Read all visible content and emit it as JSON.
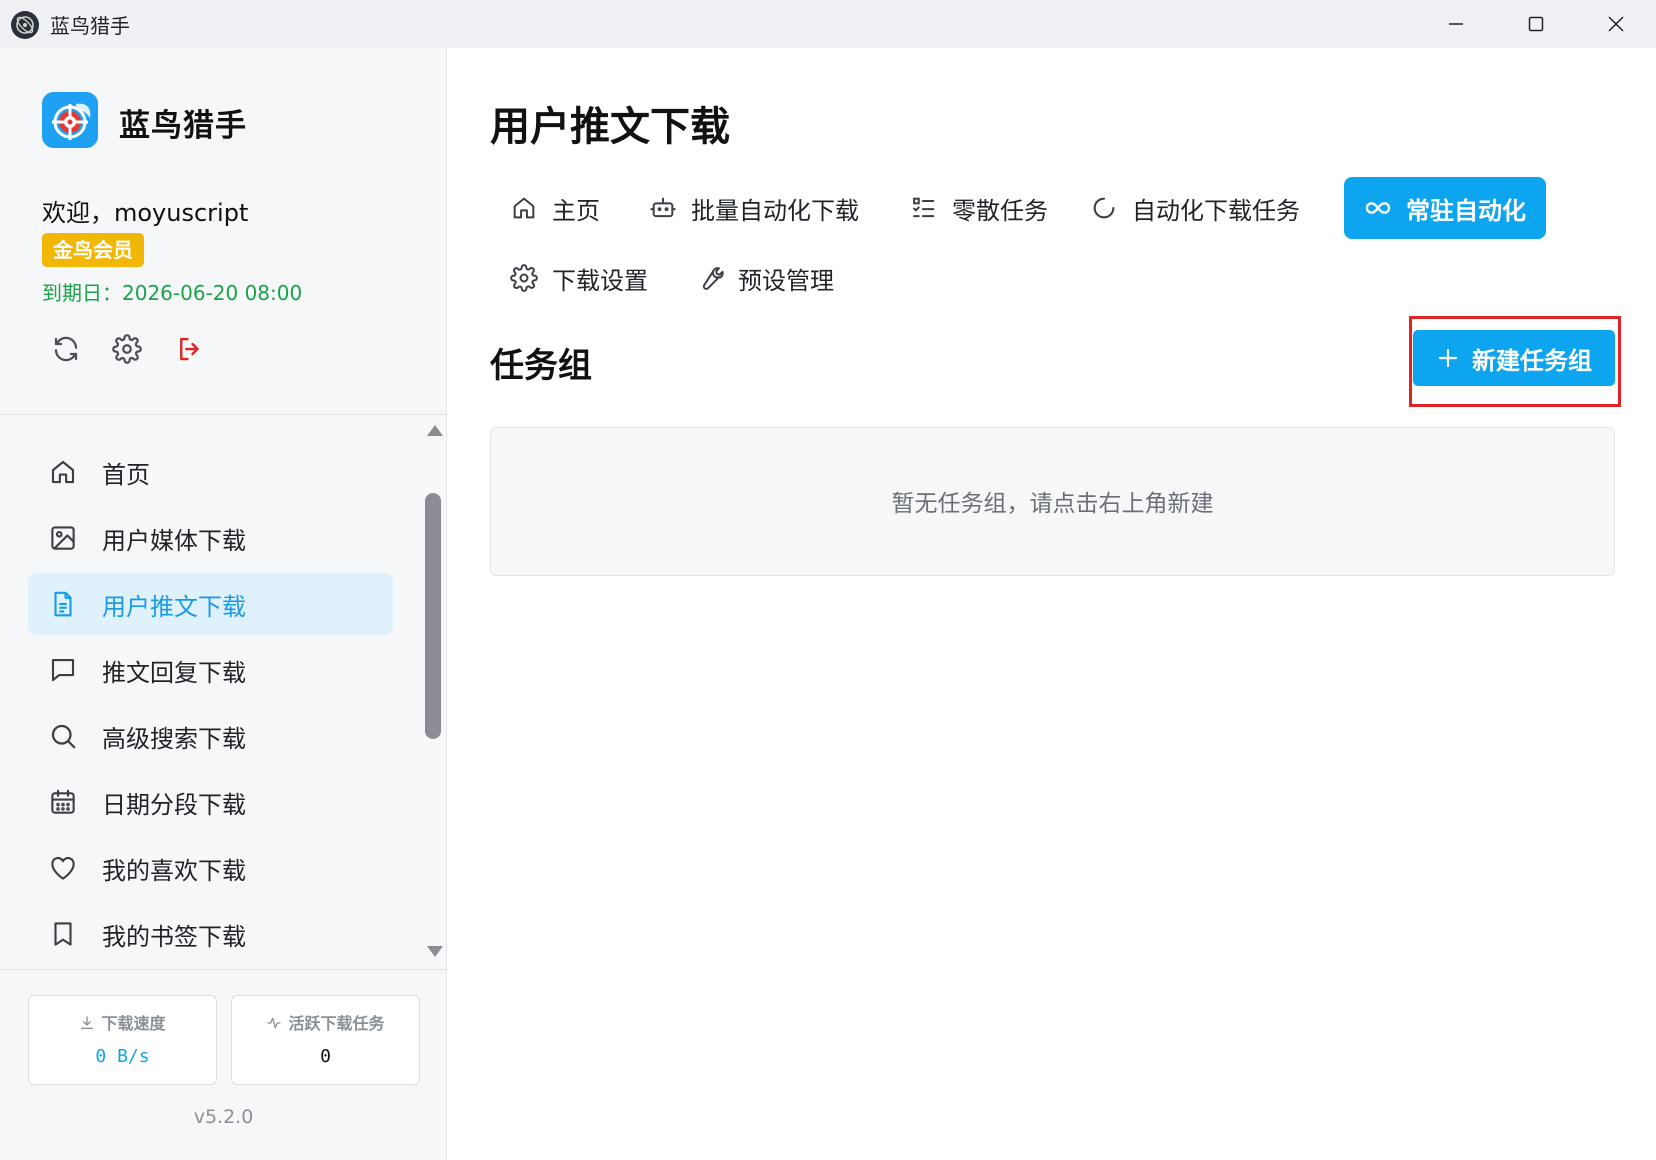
{
  "window": {
    "title": "蓝鸟猎手"
  },
  "sidebar": {
    "brand": "蓝鸟猎手",
    "welcome": "欢迎，moyuscript",
    "membership_badge": "金鸟会员",
    "expire": "到期日：2026-06-20 08:00",
    "actions": [
      {
        "name": "refresh",
        "icon": "refresh-icon"
      },
      {
        "name": "settings",
        "icon": "gear-icon"
      },
      {
        "name": "logout",
        "icon": "logout-icon"
      }
    ],
    "nav_items": [
      {
        "label": "首页",
        "icon": "home-icon",
        "active": false
      },
      {
        "label": "用户媒体下载",
        "icon": "image-icon",
        "active": false
      },
      {
        "label": "用户推文下载",
        "icon": "document-icon",
        "active": true
      },
      {
        "label": "推文回复下载",
        "icon": "chat-bubble-icon",
        "active": false
      },
      {
        "label": "高级搜索下载",
        "icon": "search-icon",
        "active": false
      },
      {
        "label": "日期分段下载",
        "icon": "calendar-icon",
        "active": false
      },
      {
        "label": "我的喜欢下载",
        "icon": "heart-icon",
        "active": false
      },
      {
        "label": "我的书签下载",
        "icon": "bookmark-icon",
        "active": false
      }
    ],
    "stats": {
      "speed_title": "下载速度",
      "speed_value": "0 B/s",
      "active_title": "活跃下载任务",
      "active_value": "0"
    },
    "version": "v5.2.0"
  },
  "main": {
    "page_title": "用户推文下载",
    "tabs": [
      {
        "label": "主页",
        "icon": "home-icon",
        "active": false
      },
      {
        "label": "批量自动化下载",
        "icon": "robot-icon",
        "active": false
      },
      {
        "label": "零散任务",
        "icon": "list-check-icon",
        "active": false
      },
      {
        "label": "自动化下载任务",
        "icon": "loading-circle-icon",
        "active": false
      },
      {
        "label": "常驻自动化",
        "icon": "infinity-icon",
        "active": true
      },
      {
        "label": "下载设置",
        "icon": "gear-icon",
        "active": false
      },
      {
        "label": "预设管理",
        "icon": "wrench-icon",
        "active": false
      }
    ],
    "section_title": "任务组",
    "new_button": "新建任务组",
    "empty_text": "暂无任务组，请点击右上角新建"
  },
  "colors": {
    "accent": "#0ea5f0",
    "badge": "#f2b705",
    "expire": "#1aa34a",
    "logout": "#e02424",
    "highlight": "#e02424"
  }
}
